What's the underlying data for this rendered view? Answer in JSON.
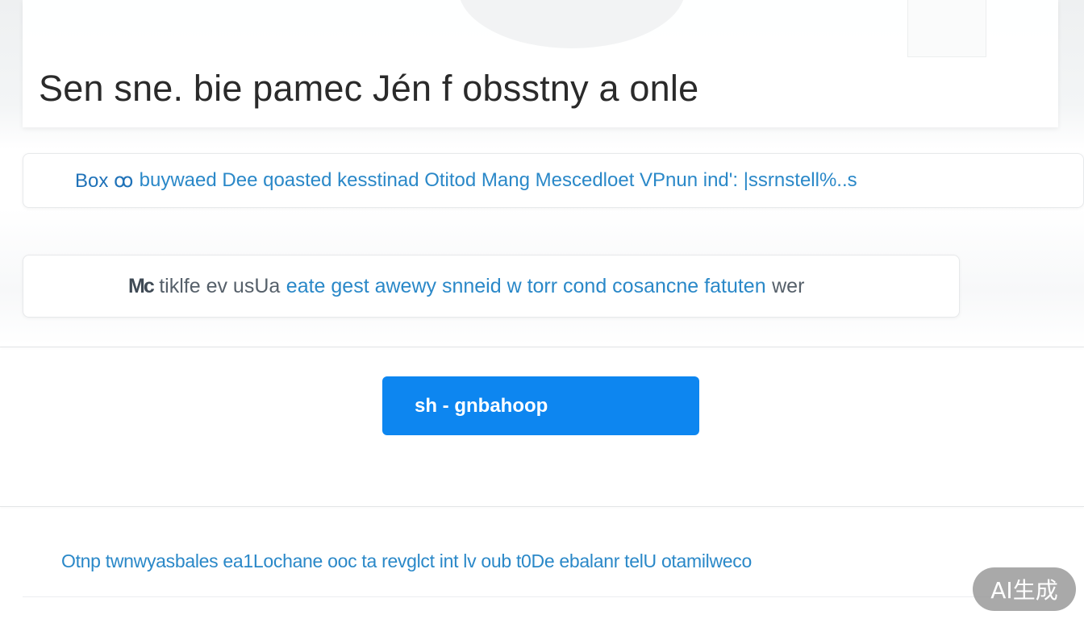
{
  "header": {
    "title": "Sen sne. bie pamec Jén f obsstny a onle"
  },
  "rows": [
    {
      "segments": [
        {
          "text": "Box ꝏ",
          "tone": "strong"
        },
        {
          "text": "buywaed Dee qoasted kesstinad Otitod Mang Mescedloet VPnun ind': |ssrnstell%..s",
          "tone": "normal"
        }
      ]
    },
    {
      "segments": [
        {
          "text": "Mc",
          "tone": "icon"
        },
        {
          "text": "tiklfe ev usUa",
          "tone": "muted"
        },
        {
          "text": "eate gest awewy snneid w torr cond cosancne fatuten",
          "tone": "normal"
        },
        {
          "text": "wer",
          "tone": "muted"
        }
      ]
    }
  ],
  "button": {
    "label": "sh -  gnbahoop"
  },
  "footer_row": {
    "text": "Otnp twnwyasbales ea1Lochane ooc ta revglct int lv oub t0De ebalanr telU otamilweco"
  },
  "badge": {
    "label": "AI生成"
  },
  "colors": {
    "accent": "#0d86f0",
    "link": "#2a88c8",
    "text": "#2a2a2a",
    "muted": "#56606a"
  }
}
